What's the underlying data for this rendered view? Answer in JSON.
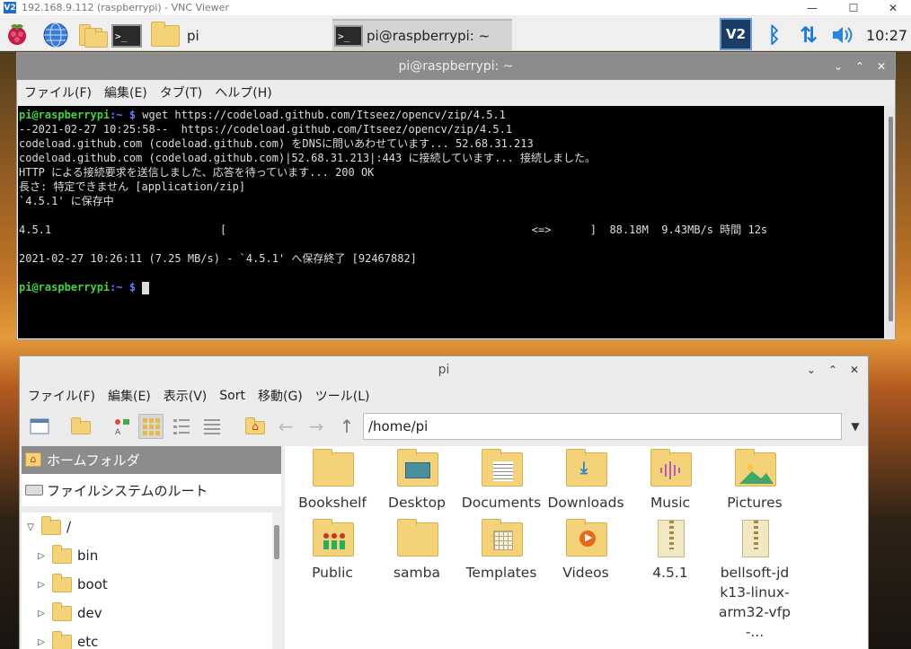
{
  "vnc": {
    "title": "192.168.9.112 (raspberrypi) - VNC Viewer",
    "logo": "V2"
  },
  "taskbar": {
    "folder_label": "pi",
    "terminal_task": "pi@raspberrypi: ~",
    "clock": "10:27",
    "tray_icons": [
      "vnc-icon",
      "bluetooth-icon",
      "network-icon",
      "volume-icon"
    ]
  },
  "terminal": {
    "title": "pi@raspberrypi: ~",
    "menu": [
      "ファイル(F)",
      "編集(E)",
      "タブ(T)",
      "ヘルプ(H)"
    ],
    "prompt_user": "pi@raspberrypi",
    "prompt_path": ":~ $",
    "command": " wget https://codeload.github.com/Itseez/opencv/zip/4.5.1",
    "output": [
      "--2021-02-27 10:25:58--  https://codeload.github.com/Itseez/opencv/zip/4.5.1",
      "codeload.github.com (codeload.github.com) をDNSに問いあわせています... 52.68.31.213",
      "codeload.github.com (codeload.github.com)|52.68.31.213|:443 に接続しています... 接続しました。",
      "HTTP による接続要求を送信しました、応答を待っています... 200 OK",
      "長さ: 特定できません [application/zip]",
      "`4.5.1' に保存中",
      "",
      "4.5.1                          [                                               <=>      ]  88.18M  9.43MB/s 時間 12s",
      "",
      "2021-02-27 10:26:11 (7.25 MB/s) - `4.5.1' へ保存終了 [92467882]",
      ""
    ]
  },
  "filemanager": {
    "title": "pi",
    "menu": [
      "ファイル(F)",
      "編集(E)",
      "表示(V)",
      "Sort",
      "移動(G)",
      "ツール(L)"
    ],
    "path": "/home/pi",
    "places": [
      "ホームフォルダ",
      "ファイルシステムのルート"
    ],
    "tree": [
      {
        "arrow": "▽",
        "name": "/"
      },
      {
        "arrow": "▷",
        "name": "bin"
      },
      {
        "arrow": "▷",
        "name": "boot"
      },
      {
        "arrow": "▷",
        "name": "dev"
      },
      {
        "arrow": "▷",
        "name": "etc"
      }
    ],
    "items": [
      {
        "name": "Bookshelf",
        "icon": "folder-icon"
      },
      {
        "name": "Desktop",
        "icon": "desktop-folder-icon"
      },
      {
        "name": "Documents",
        "icon": "documents-folder-icon"
      },
      {
        "name": "Downloads",
        "icon": "downloads-folder-icon"
      },
      {
        "name": "Music",
        "icon": "music-folder-icon"
      },
      {
        "name": "Pictures",
        "icon": "pictures-folder-icon"
      },
      {
        "name": "Public",
        "icon": "public-folder-icon"
      },
      {
        "name": "samba",
        "icon": "folder-icon"
      },
      {
        "name": "Templates",
        "icon": "templates-folder-icon"
      },
      {
        "name": "Videos",
        "icon": "videos-folder-icon"
      },
      {
        "name": "4.5.1",
        "icon": "zip-archive-icon"
      },
      {
        "name": "bellsoft-jdk13-linux-arm32-vfp-...",
        "icon": "zip-archive-icon"
      }
    ]
  }
}
